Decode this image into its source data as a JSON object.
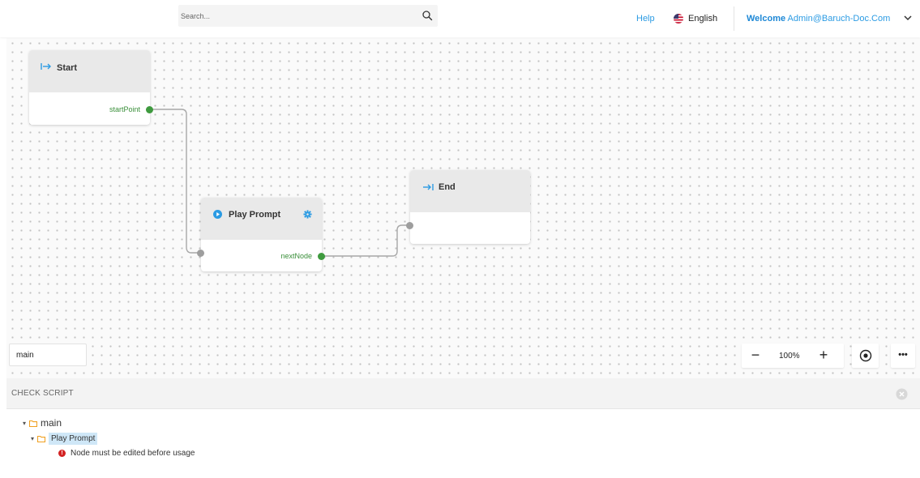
{
  "header": {
    "search_placeholder": "Search...",
    "help_label": "Help",
    "language_label": "English",
    "welcome_label": "Welcome",
    "user_email": "Admin@Baruch-Doc.Com",
    "icons": {
      "search": "search-icon",
      "flag": "us-flag-icon",
      "user_menu": "chevron-down-icon"
    }
  },
  "flow": {
    "nodes": [
      {
        "id": "start",
        "title": "Start",
        "icon": "enter-arrow-icon",
        "output": "startPoint"
      },
      {
        "id": "play-prompt",
        "title": "Play Prompt",
        "icon": "play-circle-icon",
        "settings_icon": "gear-icon",
        "output": "nextNode"
      },
      {
        "id": "end",
        "title": "End",
        "icon": "exit-arrow-icon"
      }
    ],
    "connections": [
      {
        "from": "start.startPoint",
        "to": "play-prompt"
      },
      {
        "from": "play-prompt.nextNode",
        "to": "end"
      }
    ]
  },
  "canvas_controls": {
    "tab_label": "main",
    "zoom_out_label": "—",
    "zoom_value": "100%",
    "zoom_in_label": "+",
    "fit_icon": "target-icon",
    "more_label": "•••"
  },
  "check_script": {
    "title": "CHECK SCRIPT",
    "close_icon": "close-circle-icon",
    "tree": {
      "root_label": "main",
      "child_label": "Play Prompt",
      "error_message": "Node must be edited before usage"
    }
  },
  "colors": {
    "accent": "#2b9be3",
    "port_output": "#3e9a3e",
    "port_input": "#9e9e9e",
    "error": "#d32323",
    "folder": "#f0a020",
    "selection": "#cfe7f7"
  }
}
